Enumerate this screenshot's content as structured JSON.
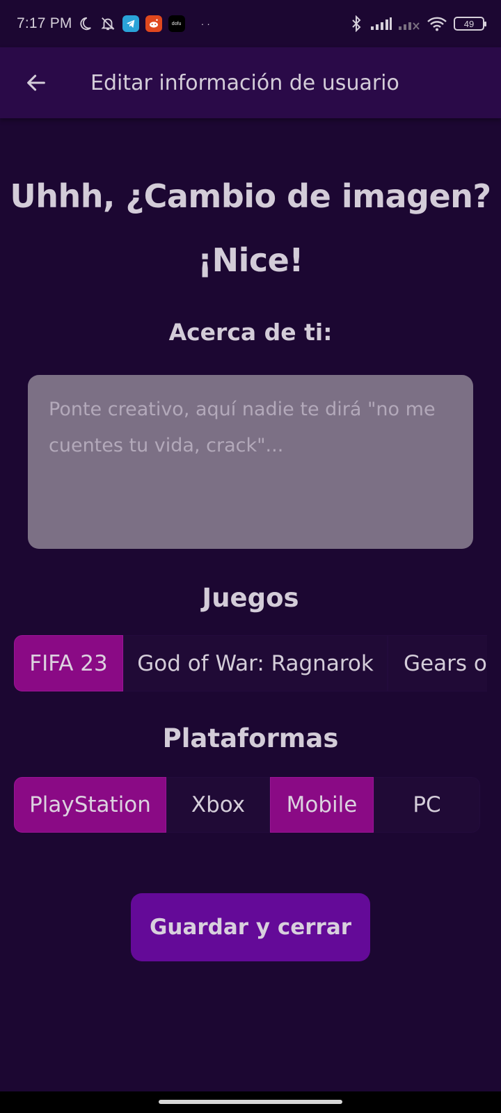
{
  "status_bar": {
    "time": "7:17 PM",
    "dofu_app_label": "dofu",
    "more_dots": "··",
    "battery_level": "49",
    "icons": [
      "moon-icon",
      "bell-off-icon",
      "telegram-icon",
      "reddit-icon",
      "dofu-app-icon",
      "bluetooth-icon",
      "signal-icon",
      "signal-no-service-icon",
      "wifi-icon",
      "battery-icon"
    ]
  },
  "app_bar": {
    "back_icon": "arrow-left-icon",
    "title": "Editar información de usuario"
  },
  "headline": {
    "line1": "Uhhh, ¿Cambio de imagen?",
    "line2": "¡Nice!"
  },
  "about": {
    "label": "Acerca de ti:",
    "value": "",
    "placeholder": "Ponte creativo, aquí nadie te dirá \"no me cuentes tu vida, crack\"..."
  },
  "games": {
    "label": "Juegos",
    "chips": [
      {
        "label": "FIFA 23",
        "selected": true
      },
      {
        "label": "God of War: Ragnarok",
        "selected": false
      },
      {
        "label": "Gears of",
        "selected": false
      }
    ]
  },
  "platforms": {
    "label": "Plataformas",
    "chips": [
      {
        "label": "PlayStation",
        "selected": true
      },
      {
        "label": "Xbox",
        "selected": false
      },
      {
        "label": "Mobile",
        "selected": true
      },
      {
        "label": "PC",
        "selected": false
      }
    ]
  },
  "save_button": {
    "label": "Guardar y cerrar"
  },
  "colors": {
    "background": "#1c0732",
    "app_bar": "#2a0a48",
    "chip_selected": "#8a0a85",
    "save_button": "#640a98",
    "textarea": "#7c7085"
  }
}
